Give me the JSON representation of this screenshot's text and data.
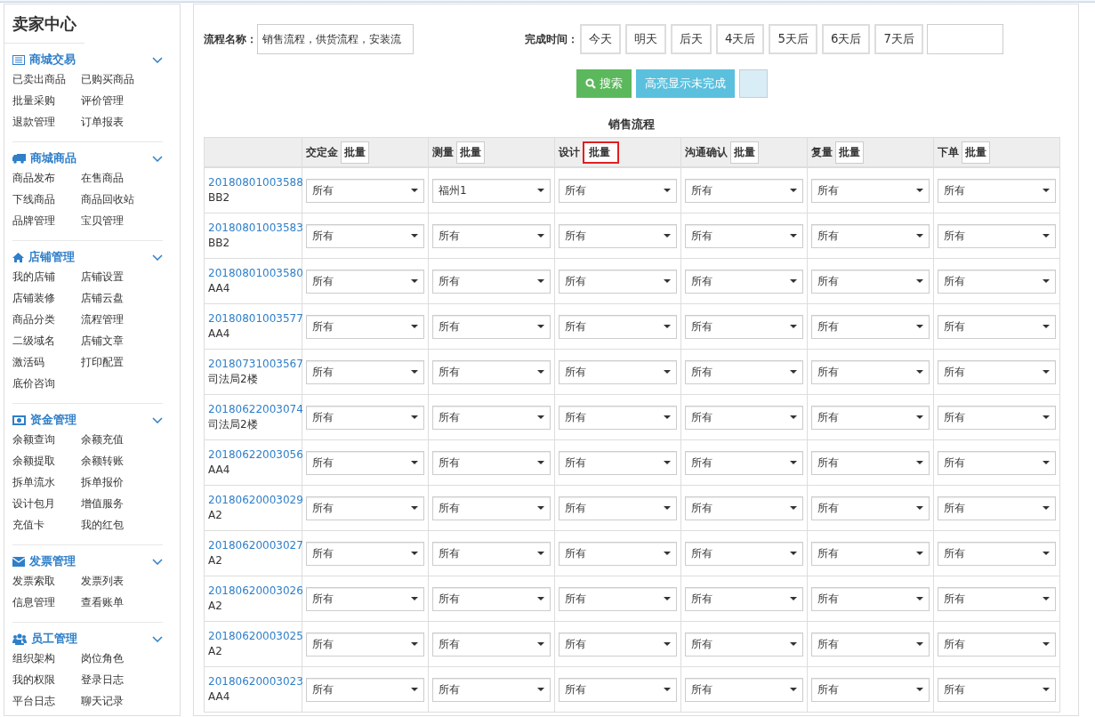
{
  "sidebar": {
    "title": "卖家中心",
    "groups": [
      {
        "title": "商城交易",
        "expanded": true,
        "items": [
          "已卖出商品",
          "已购买商品",
          "批量采购",
          "评价管理",
          "退款管理",
          "订单报表"
        ]
      },
      {
        "title": "商城商品",
        "expanded": true,
        "items": [
          "商品发布",
          "在售商品",
          "下线商品",
          "商品回收站",
          "品牌管理",
          "宝贝管理"
        ]
      },
      {
        "title": "店铺管理",
        "expanded": true,
        "items": [
          "我的店铺",
          "店铺设置",
          "店铺装修",
          "店铺云盘",
          "商品分类",
          "流程管理",
          "二级域名",
          "店铺文章",
          "激活码",
          "打印配置",
          "底价咨询"
        ]
      },
      {
        "title": "资金管理",
        "expanded": true,
        "items": [
          "余额查询",
          "余额充值",
          "余额提取",
          "余额转账",
          "拆单流水",
          "拆单报价",
          "设计包月",
          "增值服务",
          "充值卡",
          "我的红包"
        ]
      },
      {
        "title": "发票管理",
        "expanded": true,
        "items": [
          "发票索取",
          "发票列表",
          "信息管理",
          "查看账单"
        ]
      },
      {
        "title": "员工管理",
        "expanded": true,
        "items": [
          "组织架构",
          "岗位角色",
          "我的权限",
          "登录日志",
          "平台日志",
          "聊天记录"
        ]
      }
    ]
  },
  "filter": {
    "name_label": "流程名称：",
    "name_value": "销售流程，供货流程，安装流",
    "time_label": "完成时间：",
    "time_options": [
      "今天",
      "明天",
      "后天",
      "4天后",
      "5天后",
      "6天后",
      "7天后"
    ],
    "search_button": "搜索",
    "highlight_button": "高亮显示未完成"
  },
  "table": {
    "title": "销售流程",
    "columns": [
      {
        "label": "交定金",
        "batch": "批量",
        "highlighted": false
      },
      {
        "label": "测量",
        "batch": "批量",
        "highlighted": false
      },
      {
        "label": "设计",
        "batch": "批量",
        "highlighted": true
      },
      {
        "label": "沟通确认",
        "batch": "批量",
        "highlighted": false
      },
      {
        "label": "复量",
        "batch": "批量",
        "highlighted": false
      },
      {
        "label": "下单",
        "batch": "批量",
        "highlighted": false
      }
    ],
    "rows": [
      {
        "order": "20180801003588",
        "name": "BB2",
        "values": [
          "所有",
          "福州1",
          "所有",
          "所有",
          "所有",
          "所有"
        ]
      },
      {
        "order": "20180801003583",
        "name": "BB2",
        "values": [
          "所有",
          "所有",
          "所有",
          "所有",
          "所有",
          "所有"
        ]
      },
      {
        "order": "20180801003580",
        "name": "AA4",
        "values": [
          "所有",
          "所有",
          "所有",
          "所有",
          "所有",
          "所有"
        ]
      },
      {
        "order": "20180801003577",
        "name": "AA4",
        "values": [
          "所有",
          "所有",
          "所有",
          "所有",
          "所有",
          "所有"
        ]
      },
      {
        "order": "20180731003567",
        "name": "司法局2楼",
        "values": [
          "所有",
          "所有",
          "所有",
          "所有",
          "所有",
          "所有"
        ]
      },
      {
        "order": "20180622003074",
        "name": "司法局2楼",
        "values": [
          "所有",
          "所有",
          "所有",
          "所有",
          "所有",
          "所有"
        ]
      },
      {
        "order": "20180622003056",
        "name": "AA4",
        "values": [
          "所有",
          "所有",
          "所有",
          "所有",
          "所有",
          "所有"
        ]
      },
      {
        "order": "20180620003029",
        "name": "A2",
        "values": [
          "所有",
          "所有",
          "所有",
          "所有",
          "所有",
          "所有"
        ]
      },
      {
        "order": "20180620003027",
        "name": "A2",
        "values": [
          "所有",
          "所有",
          "所有",
          "所有",
          "所有",
          "所有"
        ]
      },
      {
        "order": "20180620003026",
        "name": "A2",
        "values": [
          "所有",
          "所有",
          "所有",
          "所有",
          "所有",
          "所有"
        ]
      },
      {
        "order": "20180620003025",
        "name": "A2",
        "values": [
          "所有",
          "所有",
          "所有",
          "所有",
          "所有",
          "所有"
        ]
      },
      {
        "order": "20180620003023",
        "name": "AA4",
        "values": [
          "所有",
          "所有",
          "所有",
          "所有",
          "所有",
          "所有"
        ]
      }
    ]
  }
}
